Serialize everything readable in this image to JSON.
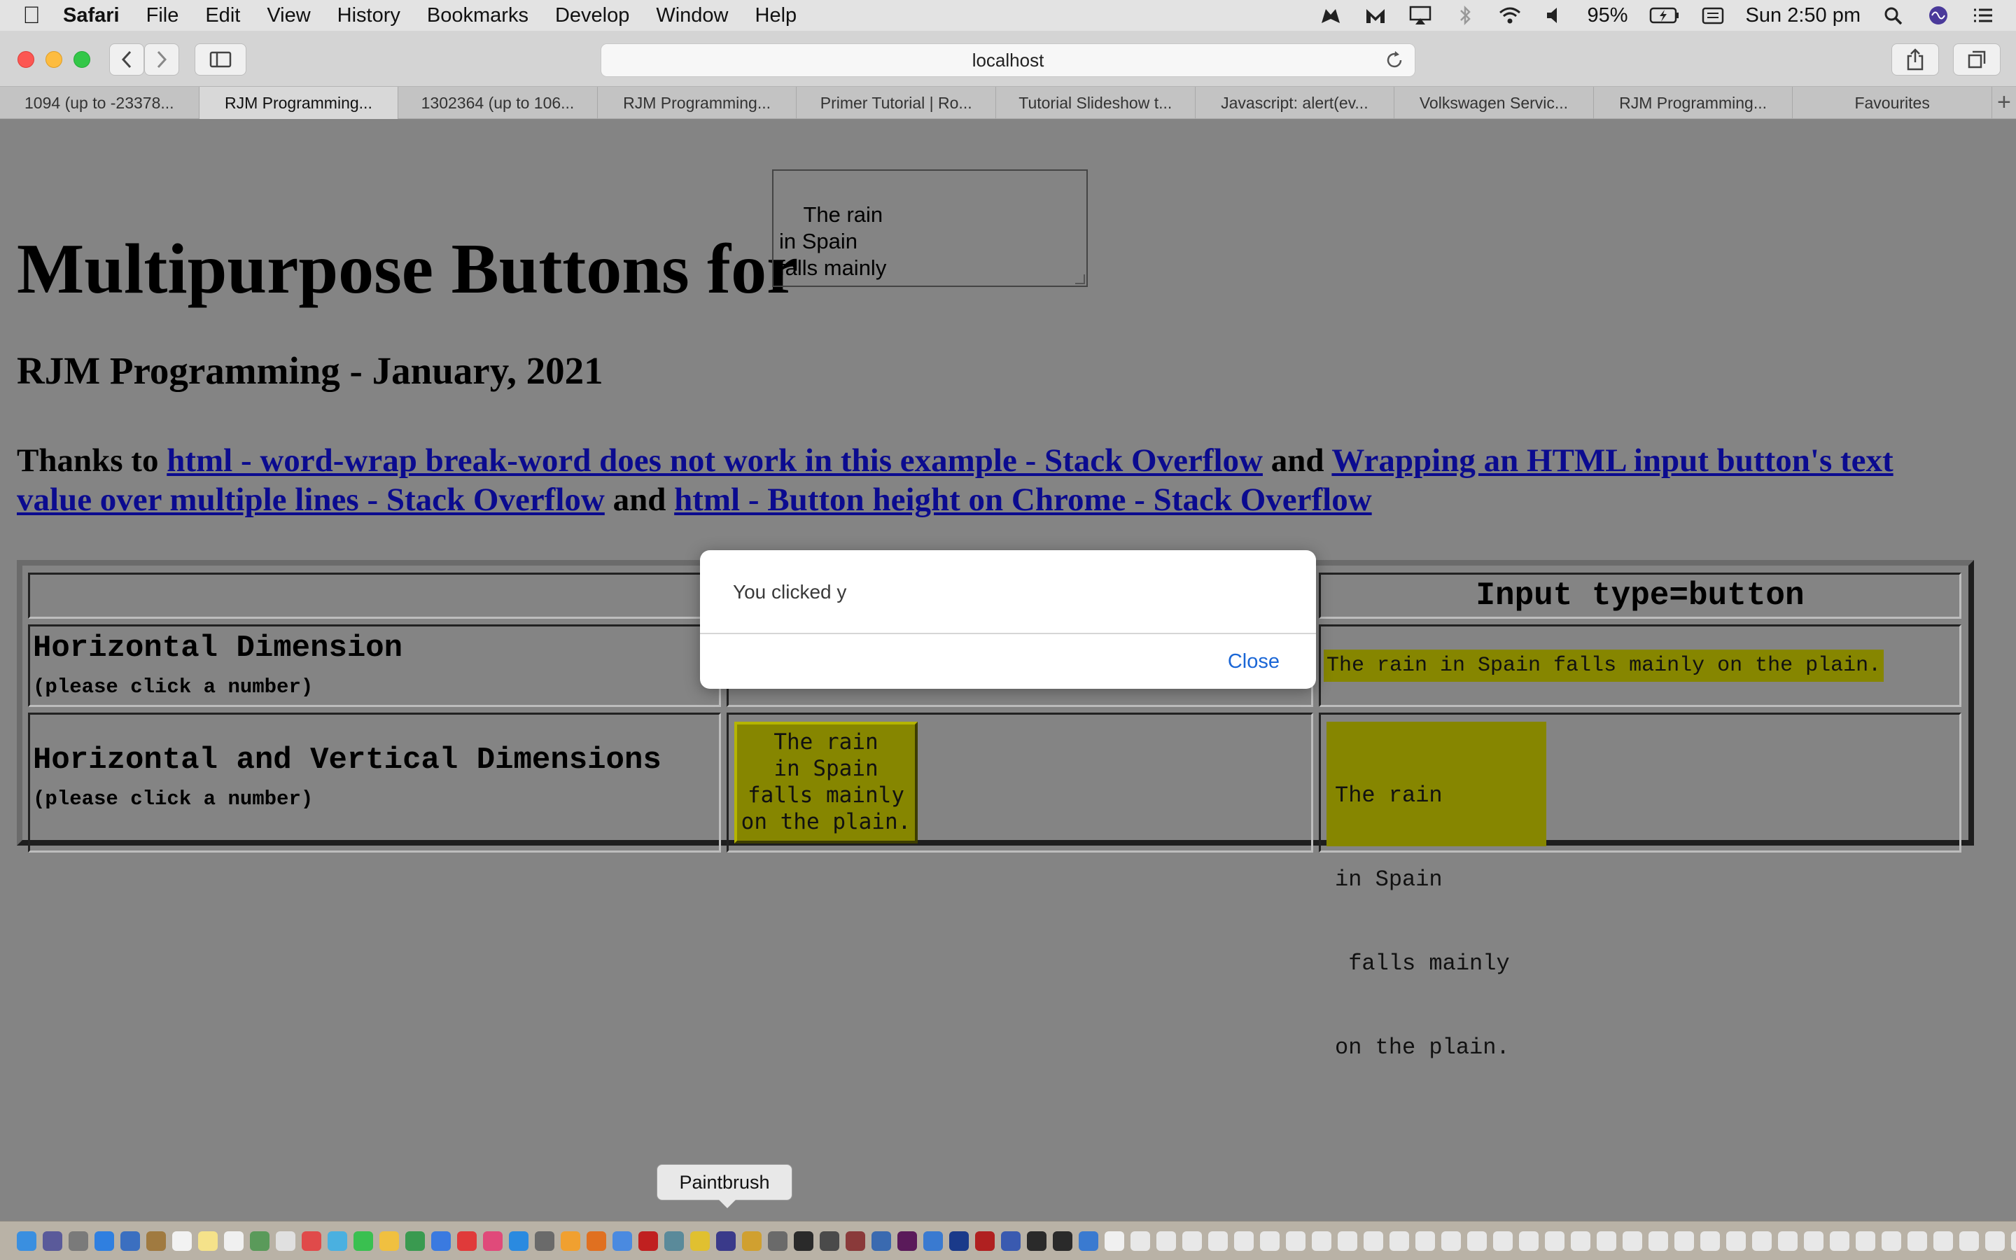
{
  "menubar": {
    "app": "Safari",
    "items": [
      "File",
      "Edit",
      "View",
      "History",
      "Bookmarks",
      "Develop",
      "Window",
      "Help"
    ],
    "battery": "95%",
    "clock": "Sun 2:50 pm"
  },
  "toolbar": {
    "url": "localhost"
  },
  "tabs": [
    "1094 (up to -23378...",
    "RJM Programming...",
    "1302364 (up to 106...",
    "RJM Programming...",
    "Primer Tutorial | Ro...",
    "Tutorial Slideshow t...",
    "Javascript: alert(ev...",
    "Volkswagen Servic...",
    "RJM Programming...",
    "Favourites"
  ],
  "page": {
    "heading": "Multipurpose Buttons for",
    "textarea_text": "The rain\nin Spain\nfalls mainly\non the plain.",
    "subheading": "RJM Programming - January, 2021",
    "thanks_prefix": "Thanks to ",
    "link1": "html - word-wrap break-word does not work in this example - Stack Overflow",
    "and1": " and ",
    "link2": "Wrapping an HTML input button's text value over multiple lines - Stack Overflow",
    "and2": " and ",
    "link3": "html - Button height on Chrome - Stack Overflow"
  },
  "table": {
    "header_input": "Input type=button",
    "row1_title": "Horizontal Dimension",
    "row1_sub": "(please click a number)",
    "row1_input_button": "The rain in Spain falls mainly on the plain.",
    "row2_title": "Horizontal and Vertical Dimensions",
    "row2_sub": "(please click a number)",
    "row2_button_lines": [
      "The rain",
      "in Spain",
      "falls mainly",
      "on the plain."
    ],
    "row2_input_lines": [
      "The rain",
      "in Spain",
      " falls mainly",
      "on the plain."
    ]
  },
  "dialog": {
    "message": "You clicked y",
    "close": "Close"
  },
  "dock": {
    "tooltip": "Paintbrush"
  },
  "colors": {
    "page_bg": "#848484",
    "button_bg": "#868600",
    "link": "#0b0b8f",
    "dialog_close": "#1a66d6"
  }
}
